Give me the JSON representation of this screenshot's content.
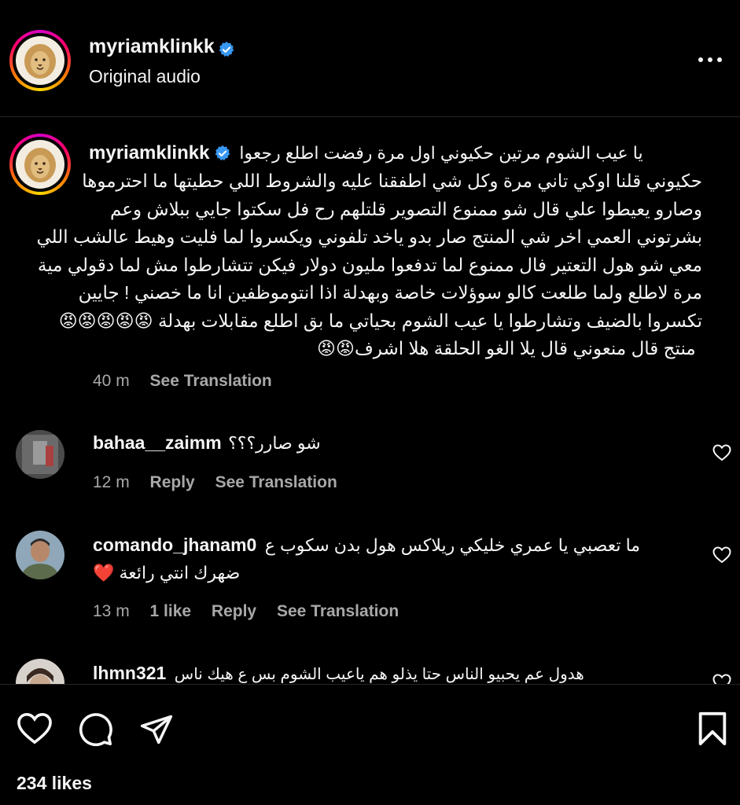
{
  "post": {
    "username": "myriamklinkk",
    "subtitle": "Original audio",
    "more_label": "•••"
  },
  "caption": {
    "username": "myriamklinkk",
    "lines": [
      "يا عيب الشوم مرتين حكيوني اول مرة رفضت اطلع رجعوا",
      "حكيوني قلنا اوكي تاني مرة وكل شي اطفقنا عليه والشروط اللي حطيتها ما احترموها",
      "وصارو يعيطوا علي قال شو ممنوع التصوير قلتلهم رح فل سكتوا جايي ببلاش وعم",
      "بشرتوني العمي اخر شي المنتج صار بدو ياخد تلفوني ويكسروا لما فليت وهيط عالشب اللي",
      "معي شو هول التعتير فال ممنوع لما تدفعوا مليون دولار فيكن تتشارطوا مش لما دقولي مية",
      "مرة لاطلع ولما طلعت كالو سوؤلات خاصة وبهدلة اذا انتوموظفين انا ما خصني ! جايين",
      "تكسروا بالضيف وتشارطوا يا عيب الشوم بحياتي ما بق اطلع مقابلات بهدلة 😡😡😡😡😡",
      "منتج قال منعوني قال يلا الغو الحلقة هلا اشرف😡😡"
    ],
    "time": "40 m",
    "see_translation": "See Translation"
  },
  "comments": [
    {
      "username": "bahaa__zaimm",
      "text": "شو صارر؟؟؟",
      "time": "12 m",
      "reply": "Reply",
      "see_translation": "See Translation"
    },
    {
      "username": "comando_jhanam0",
      "text_line1": "ما تعصبي يا عمري خليكي ريلاكس هول بدن سكوب ع",
      "text_line2": "ضهرك انتي رائعة ❤️",
      "time": "13 m",
      "likes": "1 like",
      "reply": "Reply",
      "see_translation": "See Translation"
    },
    {
      "username": "lhmn321",
      "text": "هدول عم يحبيو الناس حتا يذلو هم ياعيب الشوم بس ع هيك ناس"
    }
  ],
  "footer": {
    "likes": "234 likes"
  },
  "colors": {
    "background": "#000000",
    "text": "#f5f5f5",
    "muted": "#a8a8a8",
    "verified": "#3897f0"
  }
}
